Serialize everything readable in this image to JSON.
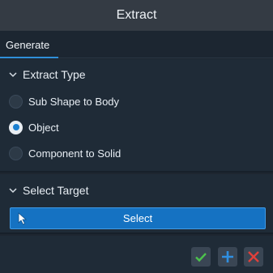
{
  "window": {
    "title": "Extract"
  },
  "tabs": [
    {
      "label": "Generate",
      "active": true
    }
  ],
  "extract_type": {
    "header": "Extract Type",
    "options": [
      {
        "label": "Sub Shape to Body",
        "checked": false
      },
      {
        "label": "Object",
        "checked": true
      },
      {
        "label": "Component to Solid",
        "checked": false
      }
    ]
  },
  "select_target": {
    "header": "Select Target",
    "button_label": "Select"
  },
  "footer": {
    "buttons": [
      {
        "icon": "check-icon",
        "color": "#4cc24c"
      },
      {
        "icon": "plus-icon",
        "color": "#2f8fe0"
      },
      {
        "icon": "close-icon",
        "color": "#e0403a"
      }
    ]
  },
  "colors": {
    "accent": "#1572c2",
    "tab_underline": "#2f8fd8"
  }
}
